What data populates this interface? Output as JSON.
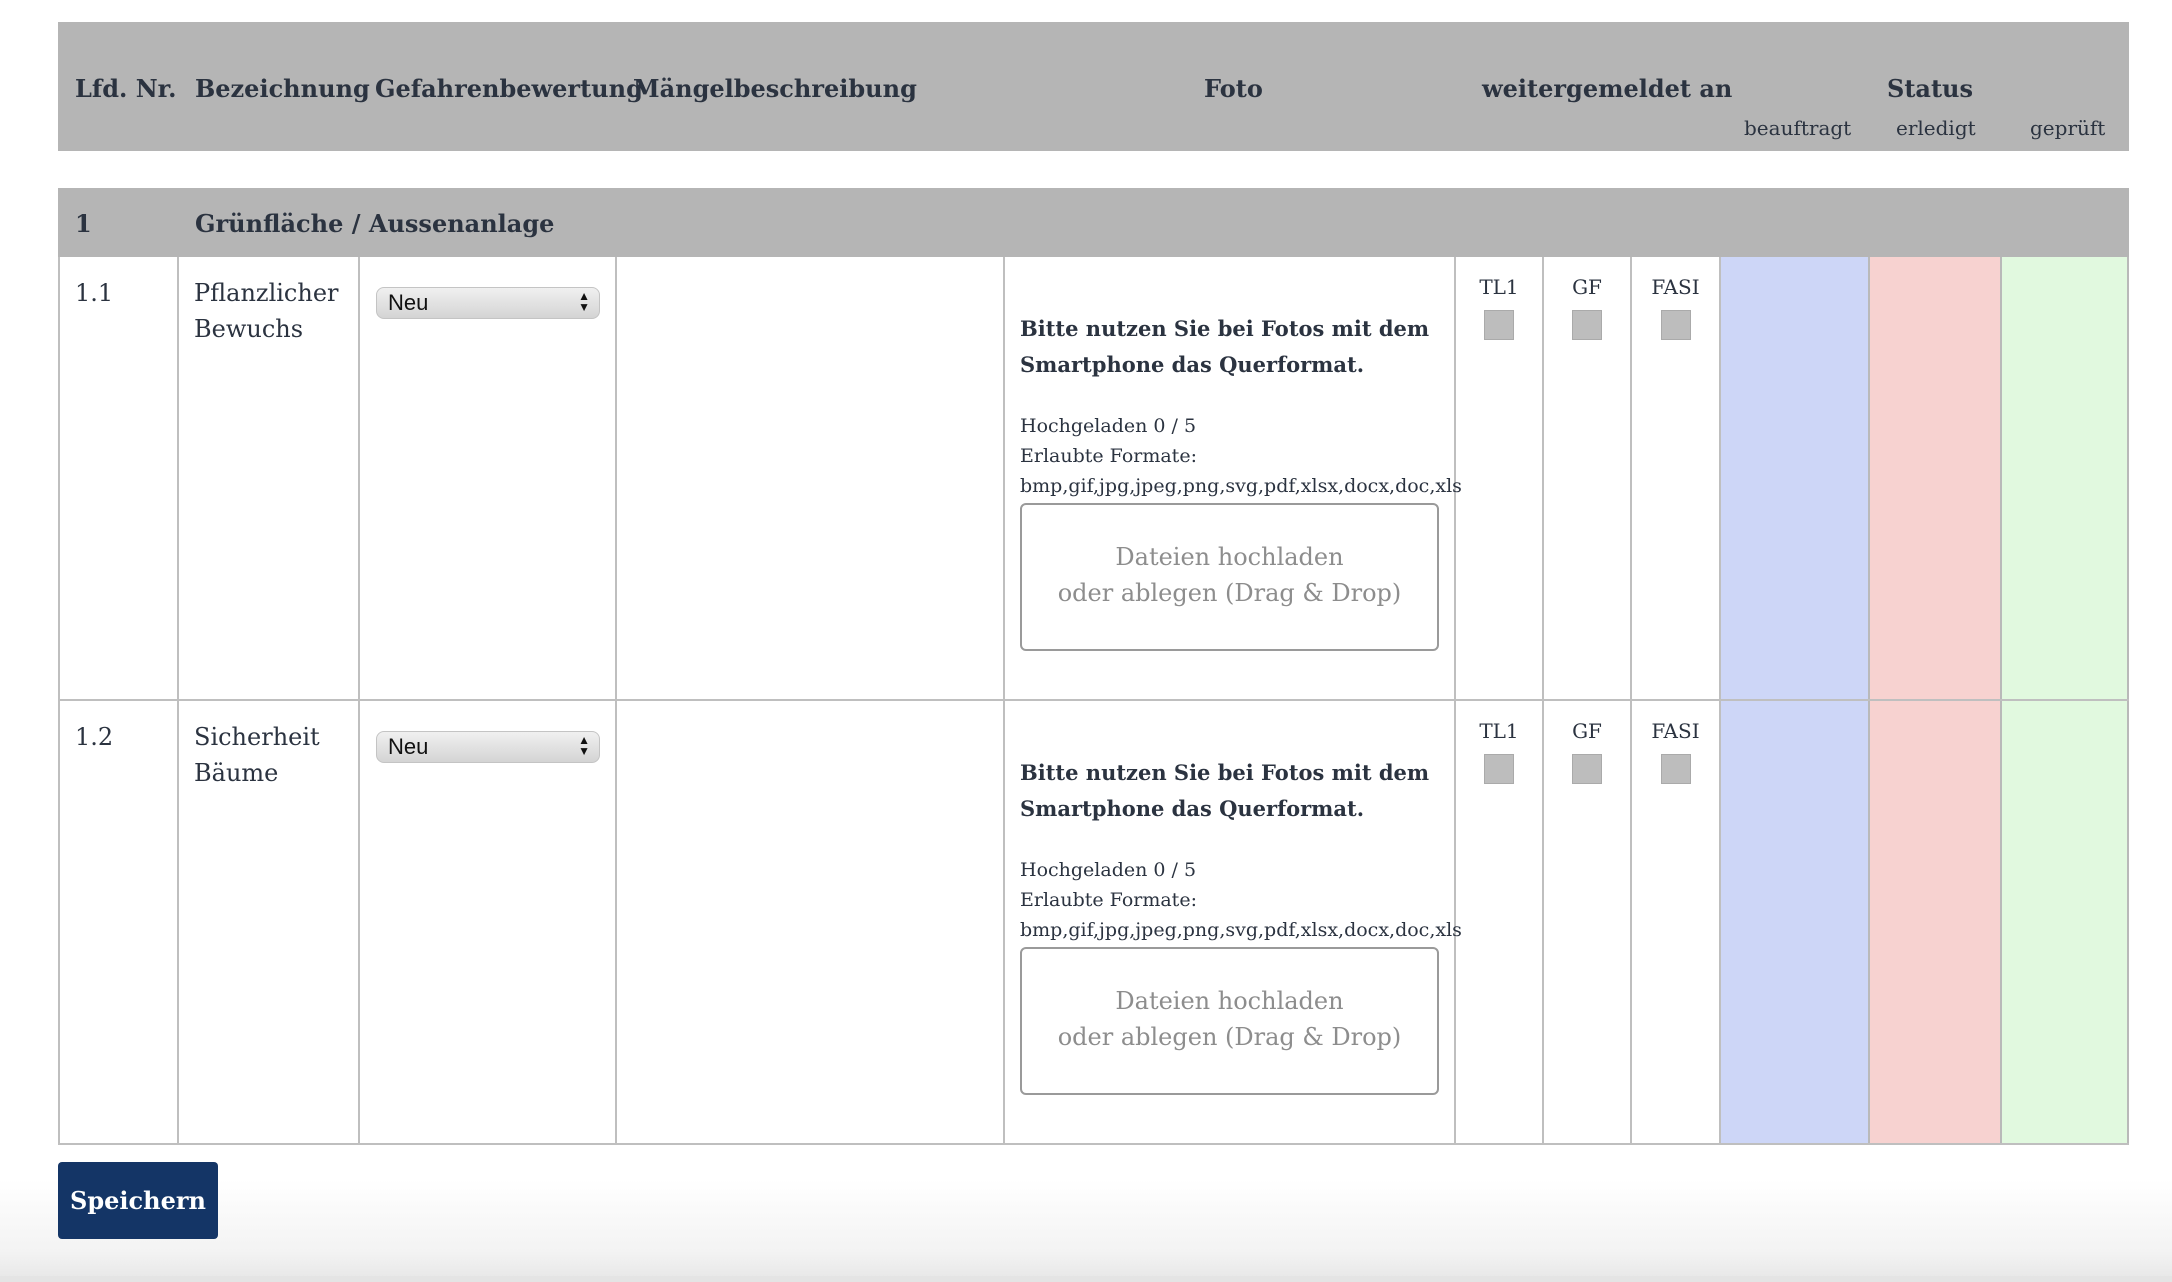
{
  "header": {
    "lfd_nr": "Lfd. Nr.",
    "bezeichnung": "Bezeichnung",
    "gefahrenbewertung": "Gefahrenbewertung",
    "maengelbeschreibung": "Mängelbeschreibung",
    "foto": "Foto",
    "weitergemeldet": "weitergemeldet an",
    "status": "Status",
    "status_sub": [
      "beauftragt",
      "erledigt",
      "geprüft"
    ]
  },
  "section": {
    "number": "1",
    "title": "Grünfläche / Aussenanlage"
  },
  "rows": [
    {
      "nr": "1.1",
      "bezeichnung_line1": "Pflanzlicher",
      "bezeichnung_line2": "Bewuchs",
      "rating": "Neu",
      "photo_note_line1": "Bitte nutzen Sie bei Fotos mit dem",
      "photo_note_line2": "Smartphone das Querformat.",
      "uploaded": "Hochgeladen 0 / 5",
      "formats_label": "Erlaubte Formate:",
      "formats": "bmp,gif,jpg,jpeg,png,svg,pdf,xlsx,docx,doc,xls",
      "dropzone_line1": "Dateien hochladen",
      "dropzone_line2": "oder ablegen (Drag & Drop)",
      "reported": [
        "TL1",
        "GF",
        "FASI"
      ]
    },
    {
      "nr": "1.2",
      "bezeichnung_line1": "Sicherheit",
      "bezeichnung_line2": "Bäume",
      "rating": "Neu",
      "photo_note_line1": "Bitte nutzen Sie bei Fotos mit dem",
      "photo_note_line2": "Smartphone das Querformat.",
      "uploaded": "Hochgeladen 0 / 5",
      "formats_label": "Erlaubte Formate:",
      "formats": "bmp,gif,jpg,jpeg,png,svg,pdf,xlsx,docx,doc,xls",
      "dropzone_line1": "Dateien hochladen",
      "dropzone_line2": "oder ablegen (Drag & Drop)",
      "reported": [
        "TL1",
        "GF",
        "FASI"
      ]
    }
  ],
  "colors": {
    "header_bg": "#b5b5b5",
    "status_beauftragt": "#cdd6f7",
    "status_erledigt": "#f7d2d0",
    "status_geprueft": "#e1f9df",
    "save_button": "#143566"
  },
  "save_label": "Speichern"
}
